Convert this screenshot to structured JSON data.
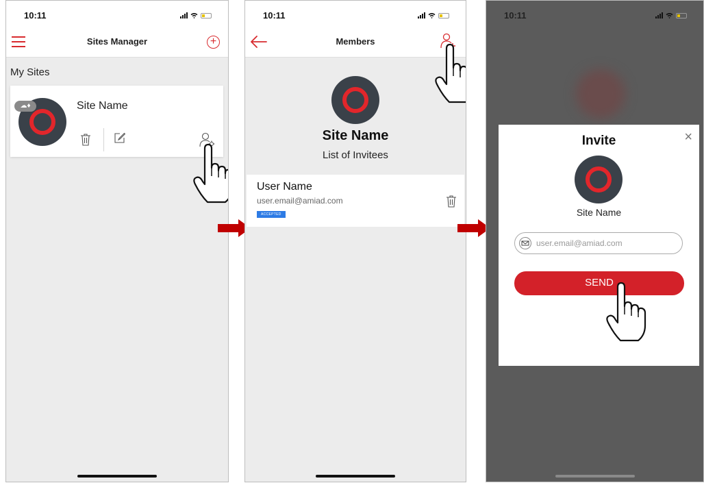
{
  "colors": {
    "brand_red": "#d82a2e",
    "send_red": "#d32129",
    "badge_blue": "#2d7be5",
    "logo_dark": "#3a4149"
  },
  "status_bar": {
    "time": "10:11"
  },
  "screen1": {
    "title": "Sites Manager",
    "section": "My Sites",
    "site_card": {
      "name": "Site Name",
      "status_chip": "☁♦"
    }
  },
  "screen2": {
    "title": "Members",
    "site_name": "Site Name",
    "list_label": "List of Invitees",
    "invitee": {
      "name": "User Name",
      "email": "user.email@amiad.com",
      "status": "ACCEPTED"
    }
  },
  "screen3": {
    "dialog": {
      "title": "Invite",
      "close": "×",
      "site_name": "Site Name",
      "email_placeholder": "user.email@amiad.com",
      "send_label": "SEND"
    }
  },
  "icons": [
    "menu-icon",
    "add-circle-icon",
    "trash-icon",
    "edit-icon",
    "user-settings-icon",
    "back-arrow-icon",
    "add-user-icon",
    "envelope-icon",
    "pointing-hand-icon",
    "flow-arrow-icon"
  ]
}
